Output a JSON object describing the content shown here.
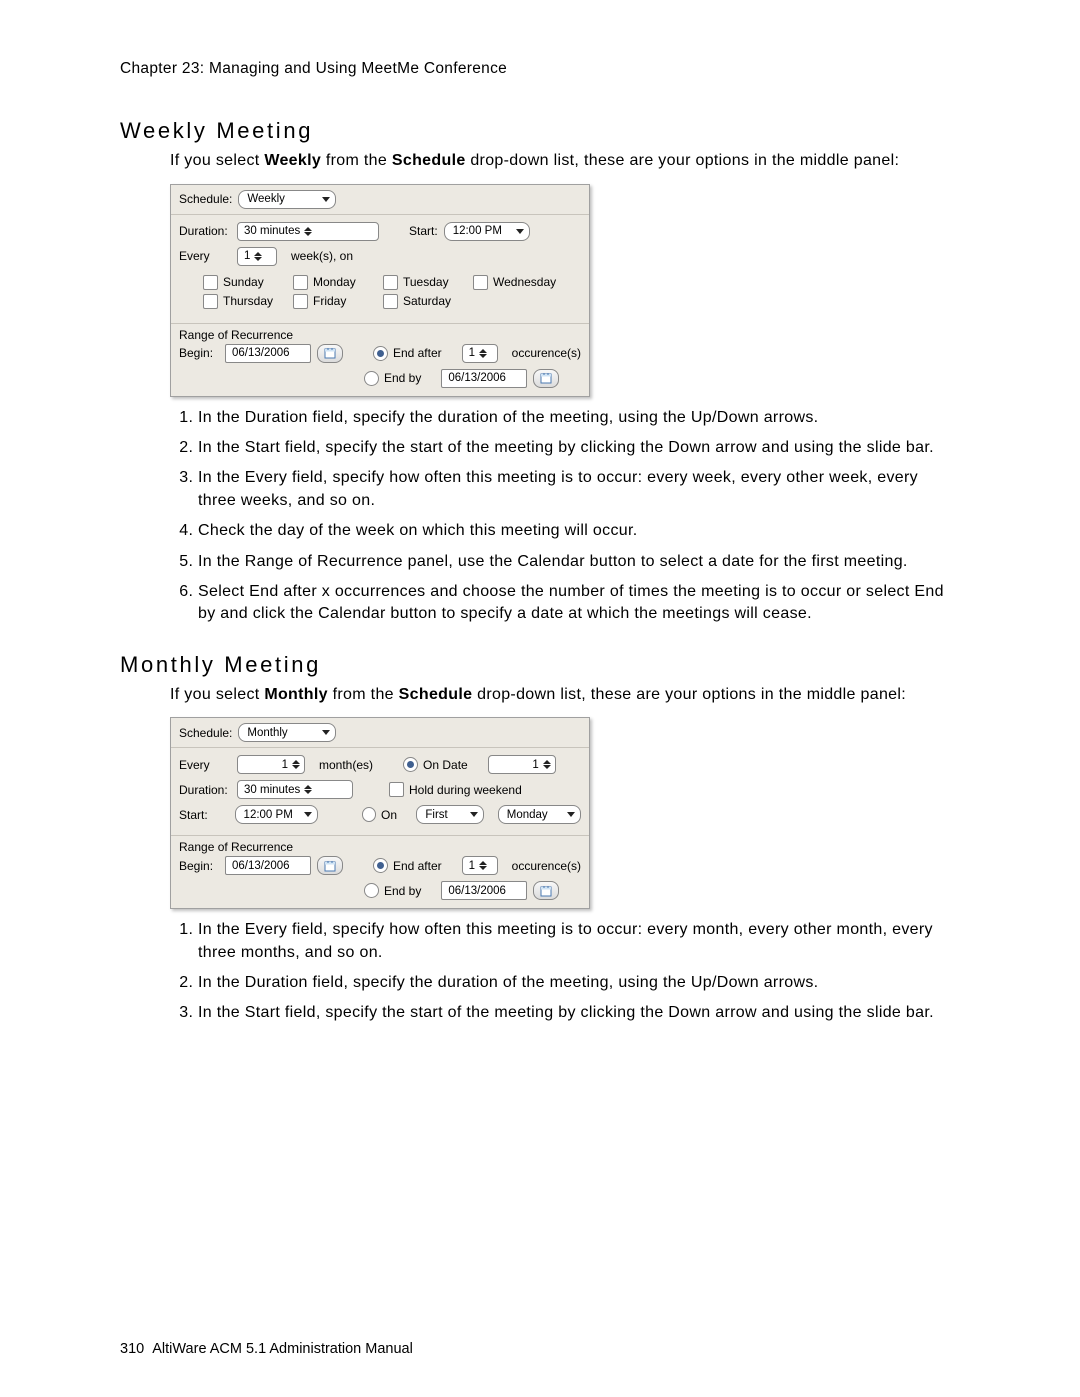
{
  "chapter": "Chapter 23:  Managing and Using MeetMe Conference",
  "weekly": {
    "heading": "Weekly Meeting",
    "intro_a": "If you select ",
    "intro_b": "Weekly",
    "intro_c": " from the ",
    "intro_d": "Schedule",
    "intro_e": " drop-down list, these are your options in the middle panel:",
    "panel": {
      "schedule_label": "Schedule:",
      "schedule_value": "Weekly",
      "duration_label": "Duration:",
      "duration_value": "30 minutes",
      "start_label": "Start:",
      "start_value": "12:00 PM",
      "every_label": "Every",
      "every_value": "1",
      "every_suffix": "week(s), on",
      "days": {
        "sun": "Sunday",
        "mon": "Monday",
        "tue": "Tuesday",
        "wed": "Wednesday",
        "thu": "Thursday",
        "fri": "Friday",
        "sat": "Saturday"
      },
      "range_label": "Range of Recurrence",
      "begin_label": "Begin:",
      "begin_value": "06/13/2006",
      "end_after_label": "End after",
      "end_after_value": "1",
      "end_after_suffix": "occurence(s)",
      "end_by_label": "End by",
      "end_by_value": "06/13/2006"
    },
    "steps": [
      "In the Duration field, specify the duration of the meeting, using the Up/Down arrows.",
      "In the Start field, specify the start of the meeting by clicking the Down arrow and using the slide bar.",
      "In the Every field, specify how often this meeting is to occur: every week, every other week, every three weeks, and so on.",
      "Check the day of the week on which this meeting will occur.",
      "In the Range of Recurrence panel, use the Calendar button to select a date for the first meeting.",
      "Select End after x occurrences and choose the number of times the meeting is to occur or select End by and click the Calendar button to specify a date at which the meetings will cease."
    ]
  },
  "monthly": {
    "heading": "Monthly Meeting",
    "intro_a": "If you select ",
    "intro_b": "Monthly",
    "intro_c": " from the ",
    "intro_d": "Schedule",
    "intro_e": " drop-down list, these are your options in the middle panel:",
    "panel": {
      "schedule_label": "Schedule:",
      "schedule_value": "Monthly",
      "every_label": "Every",
      "every_value": "1",
      "every_suffix": "month(es)",
      "ondate_label": "On Date",
      "ondate_value": "1",
      "duration_label": "Duration:",
      "duration_value": "30 minutes",
      "hold_label": "Hold during weekend",
      "start_label": "Start:",
      "start_value": "12:00 PM",
      "on_label": "On",
      "ordinal_value": "First",
      "weekday_value": "Monday",
      "range_label": "Range of Recurrence",
      "begin_label": "Begin:",
      "begin_value": "06/13/2006",
      "end_after_label": "End after",
      "end_after_value": "1",
      "end_after_suffix": "occurence(s)",
      "end_by_label": "End by",
      "end_by_value": "06/13/2006"
    },
    "steps": [
      "In the Every field, specify how often this meeting is to occur: every month, every other month, every three months, and so on.",
      "In the Duration field, specify the duration of the meeting, using the Up/Down arrows.",
      "In the Start field, specify the start of the meeting by clicking the Down arrow and using the slide bar."
    ]
  },
  "footer": {
    "page": "310",
    "title": "AltiWare ACM 5.1 Administration Manual"
  }
}
